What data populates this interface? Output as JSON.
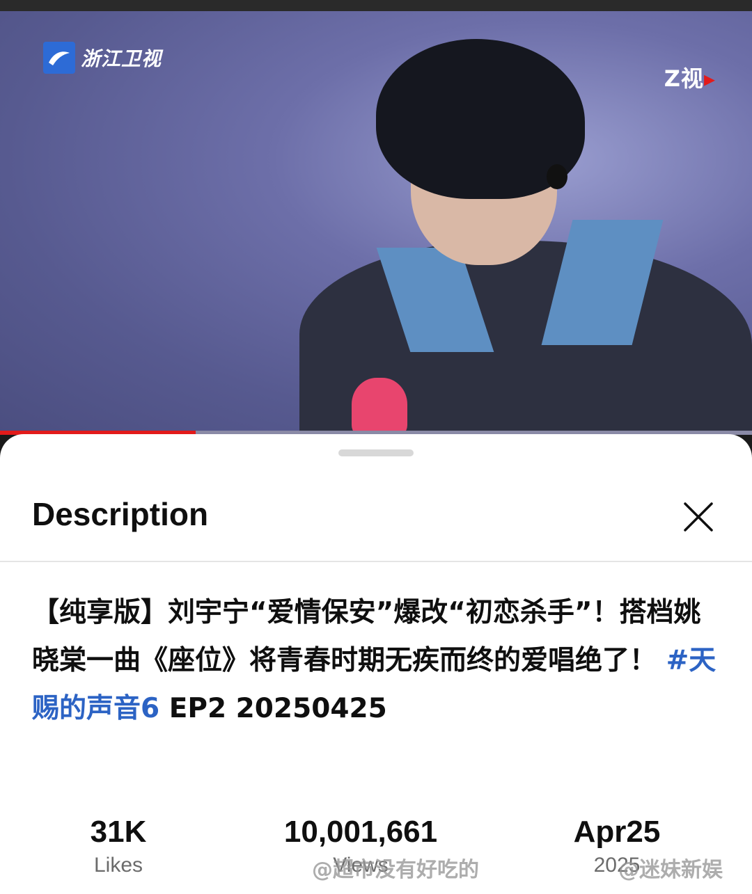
{
  "video": {
    "channel_logo_text": "浙江卫视",
    "corner_logo_text": "Z视",
    "progress_fraction": 0.26,
    "accent_color": "#e21b1b"
  },
  "sheet": {
    "title": "Description",
    "description_text": "【纯享版】刘宇宁“爱情保安”爆改“初恋杀手”！搭档姚晓棠一曲《座位》将青春时期无疾而终的爱唱绝了！ ",
    "hashtag": "#天赐的声音6",
    "description_tail": " EP2 20250425",
    "hashtag_color": "#2c63c4"
  },
  "stats": {
    "likes_value": "31K",
    "likes_label": "Likes",
    "views_value": "10,001,661",
    "views_label": "Views",
    "date_value": "Apr25",
    "date_label": "2025"
  },
  "watermarks": {
    "left": "@超市没有好吃的",
    "right": "@迷妹新娱"
  }
}
